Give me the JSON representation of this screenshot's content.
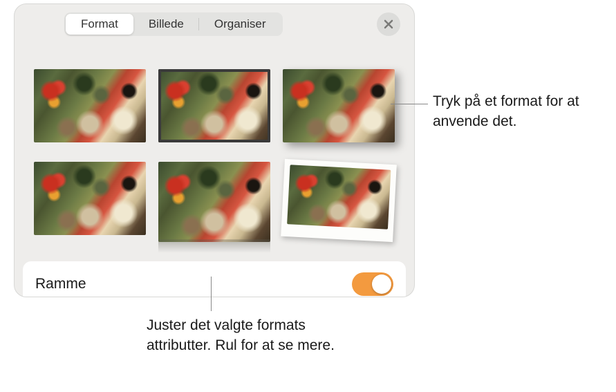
{
  "tabs": {
    "format": "Format",
    "image": "Billede",
    "organize": "Organiser"
  },
  "frame": {
    "label": "Ramme",
    "enabled": true
  },
  "callouts": {
    "tap_style": "Tryk på et format for at anvende det.",
    "adjust_attributes": "Juster det valgte formats attributter. Rul for at se mere."
  },
  "styles": [
    {
      "name": "plain"
    },
    {
      "name": "border"
    },
    {
      "name": "shadow"
    },
    {
      "name": "plain-2"
    },
    {
      "name": "reflection"
    },
    {
      "name": "polaroid"
    }
  ]
}
